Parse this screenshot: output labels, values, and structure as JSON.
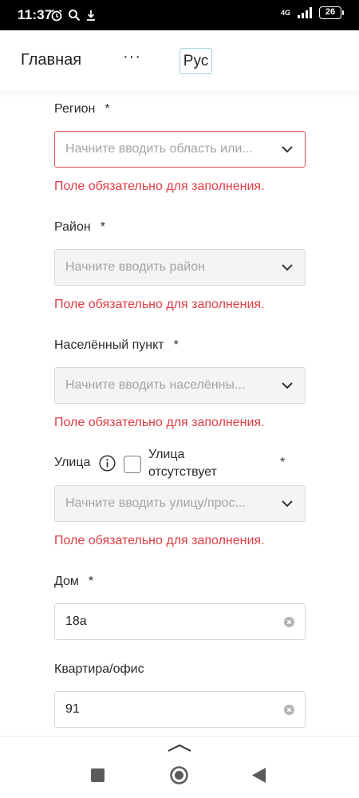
{
  "status_bar": {
    "time": "11:37",
    "network": "4G",
    "battery": "26",
    "icons": [
      "alarm-icon",
      "search-icon",
      "download-icon",
      "signal-icon",
      "battery-icon"
    ]
  },
  "header": {
    "home_label": "Главная",
    "more_label": "···",
    "language_label": "Рус"
  },
  "form": {
    "required_mark": "*",
    "error_text": "Поле обязательно для заполнения.",
    "region": {
      "label": "Регион",
      "placeholder": "Начните вводить область или..."
    },
    "district": {
      "label": "Район",
      "placeholder": "Начните вводить район"
    },
    "locality": {
      "label": "Населённый пункт",
      "placeholder": "Начните вводить населённы..."
    },
    "street": {
      "label": "Улица",
      "checkbox_label": "Улица отсутствует",
      "checkbox_checked": false,
      "placeholder": "Начните вводить улицу/прос..."
    },
    "house": {
      "label": "Дом",
      "value": "18а"
    },
    "apartment": {
      "label": "Квартира/офис",
      "value": "91"
    }
  },
  "colors": {
    "error": "#dd3d45",
    "accent_border": "#9fd5de",
    "placeholder": "#a4a4a4",
    "disabled_bg": "#f4f4f4"
  }
}
